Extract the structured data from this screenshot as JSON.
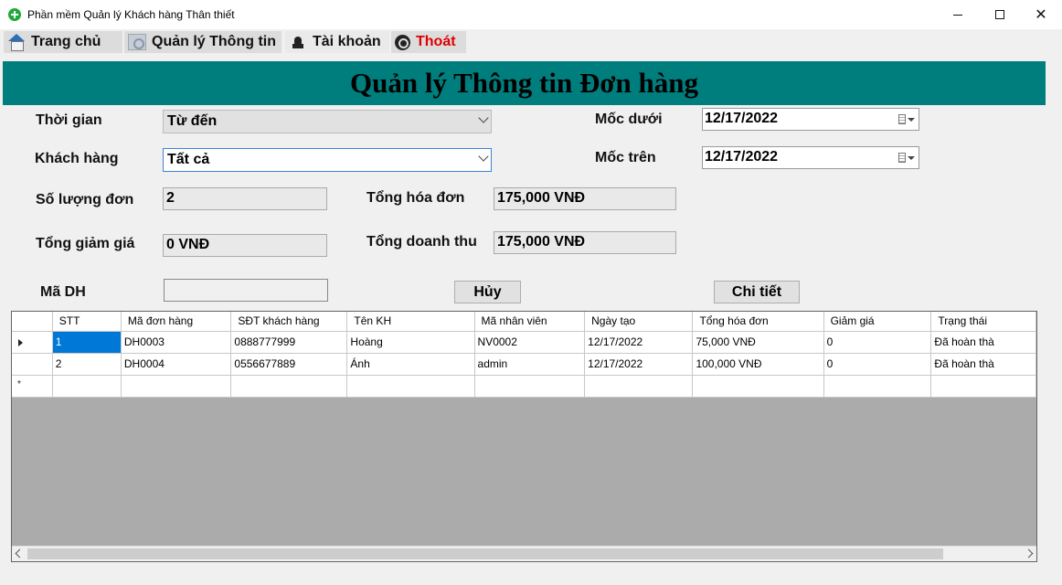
{
  "window": {
    "title": "Phần mềm Quản lý Khách hàng Thân thiết",
    "minimize_icon": "minimize-icon",
    "maximize_icon": "maximize-icon",
    "close_glyph": "✕"
  },
  "menu": {
    "home": "Trang chủ",
    "info": "Quản lý Thông tin",
    "account": "Tài khoản",
    "exit": "Thoát",
    "exit_color": "#e00000"
  },
  "header": {
    "title": "Quản lý Thông tin Đơn hàng",
    "bg_color": "#007d7d"
  },
  "filters": {
    "time_label": "Thời gian",
    "time_value": "Từ  đến",
    "customer_label": "Khách hàng",
    "customer_value": "Tất cả",
    "lower_label": "Mốc dưới",
    "lower_date": "12/17/2022",
    "upper_label": "Mốc trên",
    "upper_date": "12/17/2022"
  },
  "summary": {
    "order_count_label": "Số lượng đơn",
    "order_count": "2",
    "total_invoice_label": "Tổng hóa đơn",
    "total_invoice": "175,000 VNĐ",
    "total_discount_label": "Tổng giảm giá",
    "total_discount": "0 VNĐ",
    "total_revenue_label": "Tổng doanh thu",
    "total_revenue": "175,000 VNĐ"
  },
  "actions": {
    "order_id_label": "Mã DH",
    "order_id_value": "",
    "cancel_label": "Hủy",
    "detail_label": "Chi tiết"
  },
  "table": {
    "columns": [
      "STT",
      "Mã đơn hàng",
      "SĐT khách hàng",
      "Tên KH",
      "Mã nhân viên",
      "Ngày tạo",
      "Tổng hóa đơn",
      "Giảm giá",
      "Trạng thái"
    ],
    "rows": [
      [
        "1",
        "DH0003",
        "0888777999",
        "Hoàng",
        "NV0002",
        "12/17/2022",
        "75,000 VNĐ",
        "0",
        "Đã hoàn thà"
      ],
      [
        "2",
        "DH0004",
        "0556677889",
        "Ánh",
        "admin",
        "12/17/2022",
        "100,000 VNĐ",
        "0",
        "Đã hoàn thà"
      ]
    ],
    "new_row_marker": "*"
  }
}
